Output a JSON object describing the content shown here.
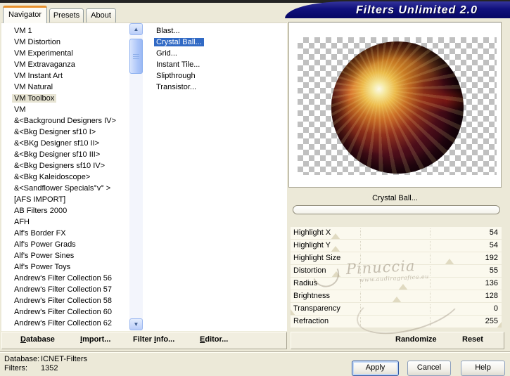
{
  "window": {
    "title": "Filters Unlimited 2.0"
  },
  "tabs": [
    {
      "label": "Navigator",
      "active": true
    },
    {
      "label": "Presets",
      "active": false
    },
    {
      "label": "About",
      "active": false
    }
  ],
  "categories": {
    "selected_index": 6,
    "items": [
      "VM 1",
      "VM Distortion",
      "VM Experimental",
      "VM Extravaganza",
      "VM Instant Art",
      "VM Natural",
      "VM Toolbox",
      "VM",
      "&<Background Designers IV>",
      "&<Bkg Designer sf10 I>",
      "&<BKg Designer sf10 II>",
      "&<Bkg Designer sf10 III>",
      "&<Bkg Designers sf10 IV>",
      "&<Bkg Kaleidoscope>",
      "&<Sandflower Specials°v° >",
      "[AFS IMPORT]",
      "AB Filters 2000",
      "AFH",
      "Alf's Border FX",
      "Alf's Power Grads",
      "Alf's Power Sines",
      "Alf's Power Toys",
      "Andrew's Filter Collection 56",
      "Andrew's Filter Collection 57",
      "Andrew's Filter Collection 58",
      "Andrew's Filter Collection 60",
      "Andrew's Filter Collection 62"
    ]
  },
  "filters": {
    "selected_index": 1,
    "items": [
      "Blast...",
      "Crystal Ball...",
      "Grid...",
      "Instant Tile...",
      "Slipthrough",
      "Transistor..."
    ]
  },
  "preview": {
    "caption": "Crystal Ball..."
  },
  "parameters": [
    {
      "label": "Highlight X",
      "value": 54,
      "max": 255
    },
    {
      "label": "Highlight Y",
      "value": 54,
      "max": 255
    },
    {
      "label": "Highlight Size",
      "value": 192,
      "max": 255
    },
    {
      "label": "Distortion",
      "value": 55,
      "max": 255
    },
    {
      "label": "Radius",
      "value": 136,
      "max": 255
    },
    {
      "label": "Brightness",
      "value": 128,
      "max": 255
    },
    {
      "label": "Transparency",
      "value": 0,
      "max": 255
    },
    {
      "label": "Refraction",
      "value": 255,
      "max": 255
    }
  ],
  "toolbar": {
    "items": [
      {
        "label": "Database",
        "underline": 0
      },
      {
        "label": "Import...",
        "underline": 0
      },
      {
        "label": "Filter Info...",
        "underline": 7
      },
      {
        "label": "Editor...",
        "underline": 0
      },
      {
        "label": "Randomize",
        "underline": null
      },
      {
        "label": "Reset",
        "underline": null
      }
    ]
  },
  "status": {
    "database_label": "Database:",
    "database_value": "ICNET-Filters",
    "filters_label": "Filters:",
    "filters_value": "1352"
  },
  "action_buttons": {
    "apply": "Apply",
    "cancel": "Cancel",
    "help": "Help"
  },
  "watermark": {
    "name": "Pinuccia",
    "url": "www.audiragrafica.eu"
  },
  "icons": {
    "scroll_up": "▲",
    "scroll_down": "▼"
  },
  "colors": {
    "dialog_background": "#ece9d8",
    "selection_blue": "#316ac5",
    "inactive_selection": "#e7e4d3",
    "banner_navy": "#10107c",
    "tab_accent_orange": "#e7902c",
    "checker_gray": "#c0c0c0"
  }
}
